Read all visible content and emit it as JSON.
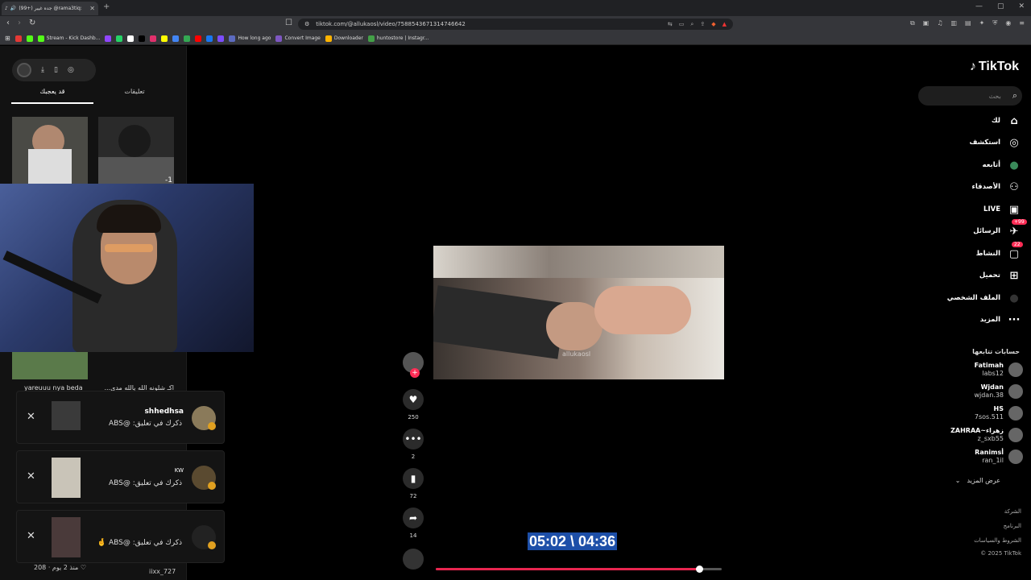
{
  "browser": {
    "tab_title": "(99+) جده غيير @rama3tiq:",
    "url": "tiktok.com/@allukaosl/video/7588543671314746642",
    "bookmarks": [
      {
        "label": "",
        "color": "#e53935"
      },
      {
        "label": "",
        "color": "#53fc18"
      },
      {
        "label": "Stream - Kick Dashb...",
        "color": "#53fc18"
      },
      {
        "label": "",
        "color": "#9146ff"
      },
      {
        "label": "",
        "color": "#25d366"
      },
      {
        "label": "",
        "color": "#ffffff"
      },
      {
        "label": "",
        "color": "#000000"
      },
      {
        "label": "",
        "color": "#e1306c"
      },
      {
        "label": "",
        "color": "#fffc00"
      },
      {
        "label": "",
        "color": "#4285f4"
      },
      {
        "label": "",
        "color": "#34a853"
      },
      {
        "label": "",
        "color": "#ff0000"
      },
      {
        "label": "",
        "color": "#1877f2"
      },
      {
        "label": "",
        "color": "#7c4dff"
      },
      {
        "label": "How long ago",
        "color": "#5c6bc0"
      },
      {
        "label": "Convert Image",
        "color": "#7e57c2"
      },
      {
        "label": "Downloader",
        "color": "#ffb300"
      },
      {
        "label": "huntostore | Instagr...",
        "color": "#43a047"
      }
    ]
  },
  "left": {
    "tab_liked": "قد يعجبك",
    "tab_comments": "تعليقات",
    "thumb_label_1": "yareuuu nya beda",
    "thumb_label_2": "اكـ شلونه الله يالله مدي...",
    "thumb_tag": "-1",
    "bottom_meta": "208 · منذ 2 يوم",
    "bottom_user": "iixx_727"
  },
  "notifications": [
    {
      "name": "shhedhsa",
      "message": "ذكرك في تعليق: @ABS"
    },
    {
      "name": "KW",
      "message": "ذكرك في تعليق: @ABS"
    },
    {
      "name": "",
      "message": "ذكرك في تعليق: @ABS 🤞"
    }
  ],
  "video": {
    "watermark": "allukaosl",
    "timecode": "05:02 \\ 04:36",
    "progress": 0.92,
    "likes": "250",
    "comments": "2",
    "saves": "72",
    "shares": "14"
  },
  "right": {
    "logo": "TikTok",
    "search_placeholder": "بحث",
    "nav": [
      {
        "label": "لك",
        "icon": "home-icon"
      },
      {
        "label": "استكشف",
        "icon": "compass-icon"
      },
      {
        "label": "أتابعه",
        "icon": "following-avatar-icon"
      },
      {
        "label": "الأصدقاء",
        "icon": "friends-icon"
      },
      {
        "label": "LIVE",
        "icon": "live-icon"
      },
      {
        "label": "الرسائل",
        "icon": "messages-icon",
        "badge": "99+"
      },
      {
        "label": "النشاط",
        "icon": "activity-icon",
        "badge": "22"
      },
      {
        "label": "تحميل",
        "icon": "upload-icon"
      },
      {
        "label": "الملف الشخصي",
        "icon": "profile-icon"
      },
      {
        "label": "المزيد",
        "icon": "more-icon"
      }
    ],
    "following_title": "حسابات تتابعها",
    "following": [
      {
        "name": "Fatimah",
        "handle": "labs12"
      },
      {
        "name": "Wjdan",
        "handle": "wjdan.38"
      },
      {
        "name": "HS",
        "handle": "7sos.511"
      },
      {
        "name": "ZAHRAA~زهراء",
        "handle": "z_sxb55"
      },
      {
        "name": "Ranimsأ",
        "handle": "ran_1il"
      }
    ],
    "see_more": "عرض المزيد",
    "footer": [
      "الشركة",
      "البرنامج",
      "الشروط والسياسات",
      "© 2025 TikTok"
    ]
  }
}
